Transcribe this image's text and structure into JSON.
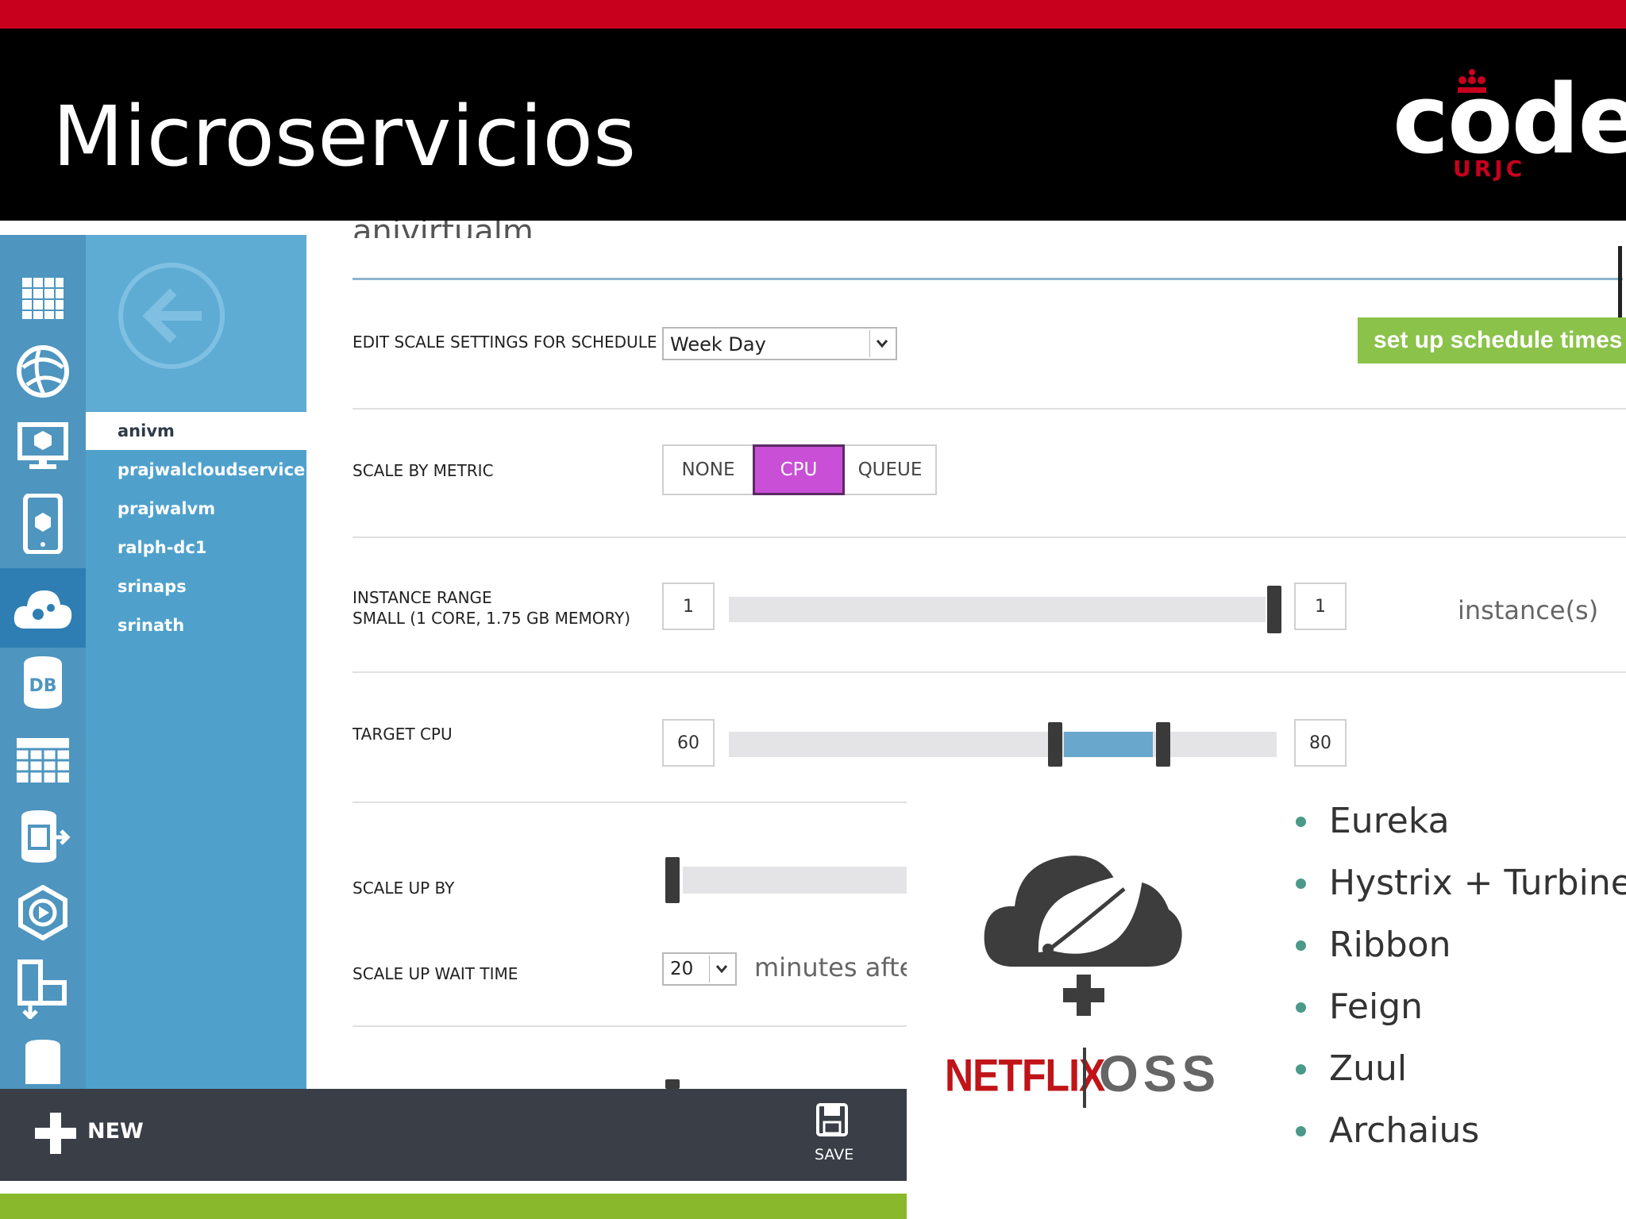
{
  "slide": {
    "title": "Microservicios",
    "logo": {
      "word": "code",
      "sub": "URJC"
    }
  },
  "portal": {
    "header_partial": "anivirtualm",
    "nav_items": [
      {
        "label": "anivm",
        "selected": true
      },
      {
        "label": "prajwalcloudservice",
        "selected": false
      },
      {
        "label": "prajwalvm",
        "selected": false
      },
      {
        "label": "ralph-dc1",
        "selected": false
      },
      {
        "label": "srinaps",
        "selected": false
      },
      {
        "label": "srinath",
        "selected": false
      }
    ],
    "schedule": {
      "label": "EDIT SCALE SETTINGS FOR SCHEDULE",
      "value": "Week Day",
      "button": "set up schedule times"
    },
    "metric": {
      "label": "SCALE BY METRIC",
      "options": [
        "NONE",
        "CPU",
        "QUEUE"
      ],
      "selected": "CPU"
    },
    "instance_range": {
      "label_line1": "INSTANCE RANGE",
      "label_line2": "SMALL (1 CORE, 1.75 GB MEMORY)",
      "min": "1",
      "max": "1",
      "unit": "instance(s)"
    },
    "target_cpu": {
      "label": "TARGET CPU",
      "min": "60",
      "max": "80"
    },
    "scale_up_by": {
      "label": "SCALE UP BY"
    },
    "scale_up_wait": {
      "label": "SCALE UP WAIT TIME",
      "value": "20",
      "suffix": "minutes after"
    },
    "commands": {
      "new": "NEW",
      "save": "SAVE"
    }
  },
  "overlay": {
    "netflix": "NETFLIX",
    "oss": "OSS",
    "bullets": [
      "Eureka",
      "Hystrix + Turbine",
      "Ribbon",
      "Feign",
      "Zuul",
      "Archaius"
    ]
  },
  "colors": {
    "top_bar": "#c8001e",
    "accent_cpu": "#c94fd6",
    "schedule_button": "#8bc24a",
    "nav_blue": "#4fa1cc",
    "rail_blue": "#4e95bf",
    "command_bar": "#393e47",
    "bottom_green": "#8ab82c"
  },
  "icons": [
    "all-items-grid-icon",
    "web-sites-icon",
    "virtual-machine-icon",
    "mobile-service-icon",
    "cloud-service-icon",
    "sql-database-icon",
    "storage-table-icon",
    "hdinsight-icon",
    "media-service-icon",
    "import-export-icon",
    "storage-icon",
    "back-arrow-icon",
    "plus-icon",
    "save-disk-icon",
    "dropdown-chevron-icon",
    "spring-cloud-leaf-icon"
  ]
}
